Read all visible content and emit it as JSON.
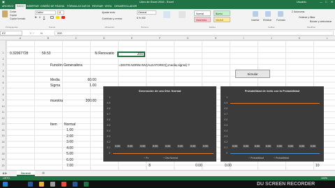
{
  "window": {
    "title": "Libro de Excel 2010 - Excel",
    "user": "Usuario"
  },
  "ribbon": {
    "tabs": [
      "ARCHIVO",
      "INICIO",
      "INSERTAR",
      "DISEÑO DE PÁGINA",
      "FÓRMULAS",
      "DATOS",
      "REVISAR",
      "VISTA",
      "DESARROLLADOR"
    ],
    "active_tab": "INICIO",
    "clipboard": {
      "cut": "Cortar",
      "copy": "Copiar",
      "format": "Copiar formato",
      "group": "Portapapeles"
    },
    "font": {
      "name": "Calibri",
      "size": "11",
      "group": "Fuente"
    },
    "alignment": {
      "wrap": "Ajustar texto",
      "merge": "Combinar y centrar",
      "group": "Alineación"
    },
    "number": {
      "format": "General",
      "group": "Número"
    },
    "styles": {
      "normal": "Normal",
      "bueno": "Bueno",
      "incorrecto": "Incorrecto",
      "neutral": "Neutral",
      "group": "Estilos"
    },
    "cells": {
      "insert": "Insertar",
      "delete": "Eliminar",
      "format": "Formato",
      "group": "Celdas"
    },
    "editing": {
      "autosum": "Autosuma",
      "sort": "Ordenar y filtrar",
      "find": "Buscar y seleccionar",
      "group": "Modificar"
    }
  },
  "formula_bar": {
    "name_box": "E2",
    "fx": "fx",
    "value": "200"
  },
  "columns": [
    "A",
    "B",
    "C",
    "D",
    "E",
    "F",
    "G",
    "H",
    "I",
    "J",
    "K",
    "L"
  ],
  "rows": [
    "1",
    "2",
    "3",
    "4",
    "5",
    "6",
    "7",
    "8",
    "9",
    "10",
    "11",
    "12",
    "13",
    "14",
    "15",
    "16",
    "17",
    "18",
    "19",
    "20",
    "21",
    "22"
  ],
  "cells": {
    "a1": "0.32067728",
    "b1": "59.53",
    "d1": "N Renovatio",
    "e1": "200",
    "funcion": "Función Generadora",
    "formula_text": "=DISTR.NORM.INV(ALEATORIO(),media,sigma) ?",
    "media_label": "Media",
    "media_val": "60.00",
    "sigma_label": "Sigma",
    "sigma_val": "1.00",
    "muestra_label": "muestra",
    "muestra_val": "200.00",
    "item_label": "Item",
    "normal_label": "Normal",
    "items": [
      "1.00",
      "2.00",
      "3.00",
      "4.00",
      "5.00",
      "6.00",
      "7.00",
      "8.00"
    ],
    "bottom_vals": [
      "8",
      "0.00",
      "0.00",
      "10"
    ]
  },
  "simular_button": "Simular",
  "chart1": {
    "title": "Generación de una Dist. Normal",
    "legend": [
      "Fx",
      "Dist Normal"
    ],
    "yticks": [
      "1",
      "0.9",
      "0.8",
      "0.7",
      "0.6",
      "0.5",
      "0.4",
      "0.3",
      "0.2",
      "0.1",
      "0"
    ],
    "data_labels": "0.00"
  },
  "chart2": {
    "title": "Probabilidad de éxito con la Probabilidad",
    "legend": [
      "Probabilidad",
      "Probabilidad"
    ],
    "yticks": [
      "1",
      "0.9",
      "0.8",
      "0.7",
      "0.6",
      "0.5",
      "0.4",
      "0.3",
      "0.2",
      "0.1",
      "0"
    ],
    "data_labels": "0.00"
  },
  "sheets": [
    "Normal"
  ],
  "status": {
    "ready": "LISTO",
    "zoom": "100%"
  },
  "watermark": "DU SCREEN RECORDER"
}
